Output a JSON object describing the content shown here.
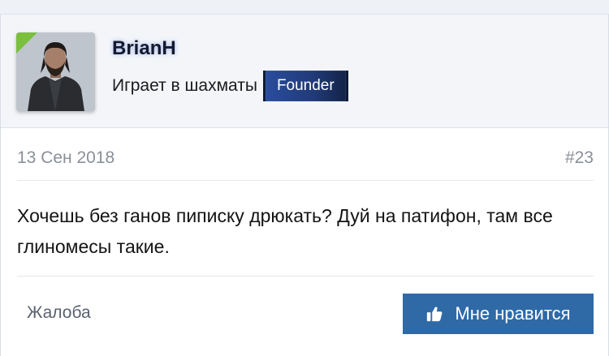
{
  "post": {
    "user": {
      "name": "BrianH",
      "title": "Играет в шахматы",
      "banner": "Founder",
      "online": true
    },
    "date": "13 Сен 2018",
    "number": "#23",
    "message": "Хочешь без ганов пиписку дрюкать? Дуй на патифон, там все глиномесы такие.",
    "actions": {
      "report_label": "Жалоба",
      "like_label": "Мне нравится"
    }
  },
  "colors": {
    "like_button": "#2f6aa7",
    "banner": "#213a78",
    "online": "#7bbf3f"
  },
  "icons": {
    "like": "thumbs-up-icon"
  }
}
